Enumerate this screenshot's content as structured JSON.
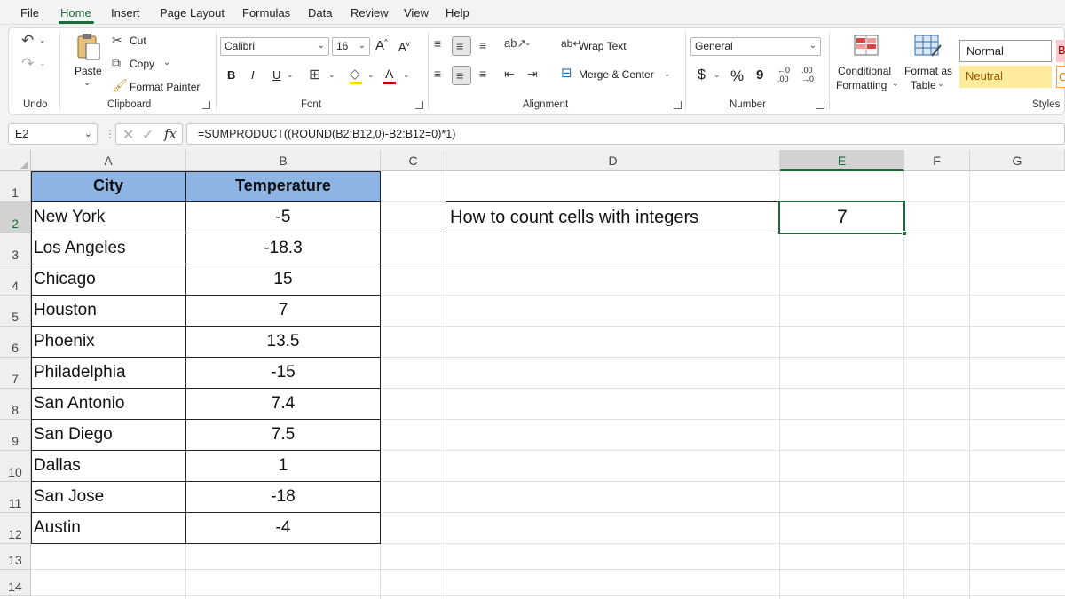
{
  "menu": [
    "File",
    "Home",
    "Insert",
    "Page Layout",
    "Formulas",
    "Data",
    "Review",
    "View",
    "Help"
  ],
  "ribbon": {
    "undo_group": "Undo",
    "clipboard": {
      "paste": "Paste",
      "cut": "Cut",
      "copy": "Copy",
      "format_painter": "Format Painter",
      "label": "Clipboard"
    },
    "font": {
      "name": "Calibri",
      "size": "16",
      "bold": "B",
      "italic": "I",
      "underline": "U",
      "label": "Font"
    },
    "alignment": {
      "wrap_text": "Wrap Text",
      "merge_center": "Merge & Center",
      "label": "Alignment"
    },
    "number": {
      "format": "General",
      "currency": "$",
      "percent": "%",
      "comma": "9",
      "label": "Number"
    },
    "styles": {
      "conditional": "Conditional",
      "formatting": "Formatting",
      "format_as": "Format as",
      "table": "Table",
      "normal": "Normal",
      "neutral": "Neutral",
      "bad_partial": "B",
      "good_partial": "C",
      "label": "Styles"
    }
  },
  "formula_bar": {
    "name_box": "E2",
    "fx": "fx",
    "formula": "=SUMPRODUCT((ROUND(B2:B12,0)-B2:B12=0)*1)"
  },
  "columns": [
    "A",
    "B",
    "C",
    "D",
    "E",
    "F",
    "G"
  ],
  "rows": [
    "1",
    "2",
    "3",
    "4",
    "5",
    "6",
    "7",
    "8",
    "9",
    "10",
    "11",
    "12",
    "13",
    "14"
  ],
  "table": {
    "headers": [
      "City",
      "Temperature"
    ],
    "rows": [
      [
        "New York",
        "-5"
      ],
      [
        "Los Angeles",
        "-18.3"
      ],
      [
        "Chicago",
        "15"
      ],
      [
        "Houston",
        "7"
      ],
      [
        "Phoenix",
        "13.5"
      ],
      [
        "Philadelphia",
        "-15"
      ],
      [
        "San Antonio",
        "7.4"
      ],
      [
        "San Diego",
        "7.5"
      ],
      [
        "Dallas",
        "1"
      ],
      [
        "San Jose",
        "-18"
      ],
      [
        "Austin",
        "-4"
      ]
    ]
  },
  "summary": {
    "label": "How to count cells with integers",
    "value": "7"
  },
  "colors": {
    "accent": "#1d6b3b",
    "header_fill": "#8eb4e3",
    "neutral_fill": "#ffeb9c",
    "neutral_text": "#9c5700"
  }
}
